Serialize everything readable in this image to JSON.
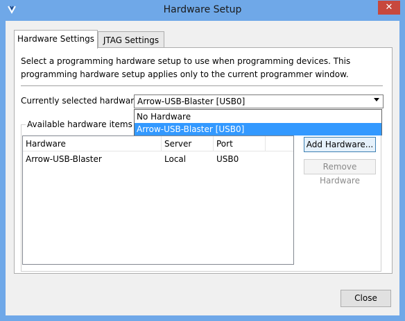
{
  "window": {
    "title": "Hardware Setup",
    "close_glyph": "✕",
    "app_icon": "quartus-programmer-icon",
    "accent": "#6fa8e8"
  },
  "tabs": [
    {
      "label": "Hardware Settings",
      "selected": true
    },
    {
      "label": "JTAG Settings",
      "selected": false
    }
  ],
  "description": "Select a programming hardware setup to use when programming devices. This programming hardware setup applies only to the current programmer window.",
  "current_hardware": {
    "label": "Currently selected hardware:",
    "value": "Arrow-USB-Blaster [USB0]",
    "options": [
      {
        "label": "No Hardware",
        "highlighted": false
      },
      {
        "label": "Arrow-USB-Blaster [USB0]",
        "highlighted": true
      }
    ]
  },
  "available": {
    "group_label": "Available hardware items",
    "columns": [
      "Hardware",
      "Server",
      "Port"
    ],
    "rows": [
      [
        "Arrow-USB-Blaster",
        "Local",
        "USB0"
      ]
    ]
  },
  "buttons": {
    "add_hardware": "Add Hardware...",
    "remove_hardware": "Remove Hardware",
    "close": "Close"
  }
}
